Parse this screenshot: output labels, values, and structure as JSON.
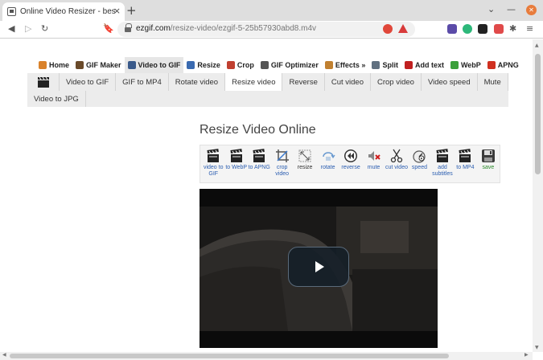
{
  "browser": {
    "tab_title": "Online Video Resizer - best_ap",
    "tab_close": "×",
    "new_tab": "+",
    "url_domain": "ezgif.com",
    "url_path": "/resize-video/ezgif-5-25b57930abd8.m4v"
  },
  "main_menu": [
    {
      "label": "Home",
      "icon": "home-icon",
      "color": "#d9822b"
    },
    {
      "label": "GIF Maker",
      "icon": "gif-maker-icon",
      "color": "#6a4a2a"
    },
    {
      "label": "Video to GIF",
      "icon": "video-to-gif-icon",
      "color": "#3a5a8a"
    },
    {
      "label": "Resize",
      "icon": "resize-icon",
      "color": "#3a6ab0"
    },
    {
      "label": "Crop",
      "icon": "crop-icon",
      "color": "#c04030"
    },
    {
      "label": "GIF Optimizer",
      "icon": "optimizer-icon",
      "color": "#555555"
    },
    {
      "label": "Effects »",
      "icon": "effects-icon",
      "color": "#c08030"
    },
    {
      "label": "Split",
      "icon": "split-icon",
      "color": "#607080"
    },
    {
      "label": "Add text",
      "icon": "add-text-icon",
      "color": "#c02020"
    },
    {
      "label": "WebP",
      "icon": "webp-icon",
      "color": "#3aa03a"
    },
    {
      "label": "APNG",
      "icon": "apng-icon",
      "color": "#d03020"
    }
  ],
  "sub_menu_row1": [
    "Video to GIF",
    "GIF to MP4",
    "Rotate video",
    "Resize video",
    "Reverse",
    "Cut video",
    "Crop video",
    "Video speed",
    "Mute"
  ],
  "sub_menu_row2": [
    "Video to JPG"
  ],
  "page_title": "Resize Video Online",
  "tools": [
    {
      "label": "video to GIF",
      "icon": "clapperboard-icon"
    },
    {
      "label": "to WebP",
      "icon": "clapperboard-icon"
    },
    {
      "label": "to APNG",
      "icon": "clapperboard-icon"
    },
    {
      "label": "crop video",
      "icon": "crop-tool-icon"
    },
    {
      "label": "resize",
      "icon": "resize-tool-icon"
    },
    {
      "label": "rotate",
      "icon": "rotate-icon"
    },
    {
      "label": "reverse",
      "icon": "reverse-icon"
    },
    {
      "label": "mute",
      "icon": "mute-icon"
    },
    {
      "label": "cut video",
      "icon": "scissors-icon"
    },
    {
      "label": "speed",
      "icon": "speed-icon"
    },
    {
      "label": "add subtitles",
      "icon": "clapperboard-icon"
    },
    {
      "label": "to MP4",
      "icon": "clapperboard-icon"
    },
    {
      "label": "save",
      "icon": "floppy-icon"
    }
  ]
}
